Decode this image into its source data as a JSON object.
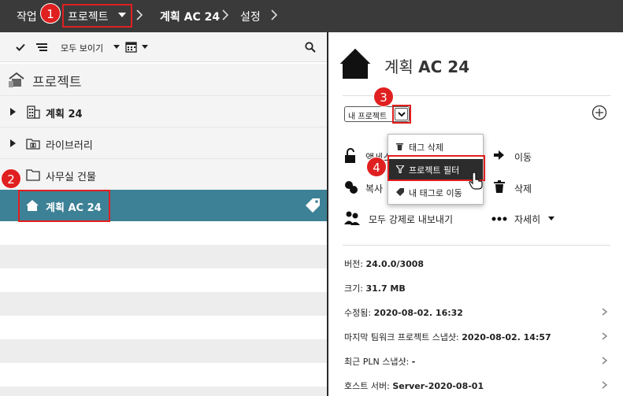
{
  "breadcrumb": {
    "items": [
      "작업",
      "프로젝트",
      "계획 AC 24",
      "설정"
    ]
  },
  "left": {
    "toolbar": {
      "show_all": "모두 보이기"
    },
    "header_title": "프로젝트",
    "tree": [
      {
        "label": "계획 24"
      },
      {
        "label": "라이브러리"
      },
      {
        "label": "사무실 건물"
      },
      {
        "label": "계획 AC 24"
      }
    ]
  },
  "right": {
    "title": "계획 AC 24",
    "dropdown_value": "내 프로젝트",
    "actions": {
      "unlock": "액세스",
      "move": "이동",
      "copy": "복사",
      "delete": "삭제",
      "export": "모두 강제로 내보내기",
      "more": "자세히"
    },
    "menu": [
      "태그 삭제",
      "프로젝트 필터",
      "내 태그로 이동"
    ],
    "info": [
      {
        "label": "버전: ",
        "value": "24.0.0/3008"
      },
      {
        "label": "크기: ",
        "value": "31.7 MB"
      },
      {
        "label": "수정됨: ",
        "value": "2020-08-02. 16:32"
      },
      {
        "label": "마지막 팀워크 프로젝트 스냅샷: ",
        "value": "2020-08-02. 14:57"
      },
      {
        "label": "최근 PLN 스냅샷: ",
        "value": "-"
      },
      {
        "label": "호스트 서버: ",
        "value": "Server-2020-08-01"
      }
    ]
  },
  "badges": [
    "1",
    "2",
    "3",
    "4"
  ],
  "colors": {
    "topbar": "#3a3a3a",
    "selected": "#3d8196",
    "highlight": "#e02020"
  }
}
